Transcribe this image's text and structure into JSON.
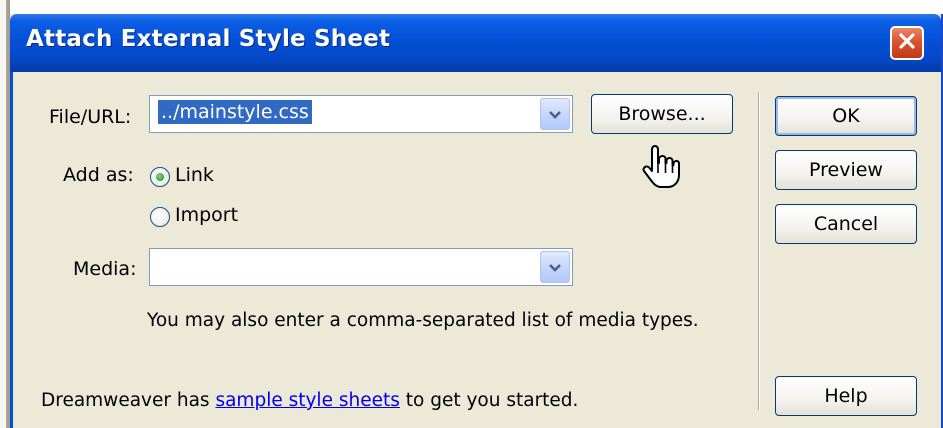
{
  "dialog": {
    "title": "Attach External Style Sheet"
  },
  "file_url": {
    "label": "File/URL:",
    "value": "../mainstyle.css",
    "browse_label": "Browse..."
  },
  "add_as": {
    "label": "Add as:",
    "options": [
      {
        "label": "Link",
        "selected": true
      },
      {
        "label": "Import",
        "selected": false
      }
    ]
  },
  "media": {
    "label": "Media:",
    "value": "",
    "hint": "You may also enter a comma-separated list of media types."
  },
  "footer": {
    "prefix": "Dreamweaver has",
    "link_text": "sample style sheets",
    "suffix": "to get you started."
  },
  "buttons": {
    "ok": "OK",
    "preview": "Preview",
    "cancel": "Cancel",
    "help": "Help"
  },
  "icons": {
    "close": "close-icon",
    "dropdown": "chevron-down-icon",
    "cursor": "hand-pointer-icon"
  },
  "colors": {
    "titlebar": "#0550d8",
    "dialog_bg": "#ece9d8",
    "selection": "#316ac5",
    "close_button": "#d9542f",
    "link": "#0000ee"
  }
}
